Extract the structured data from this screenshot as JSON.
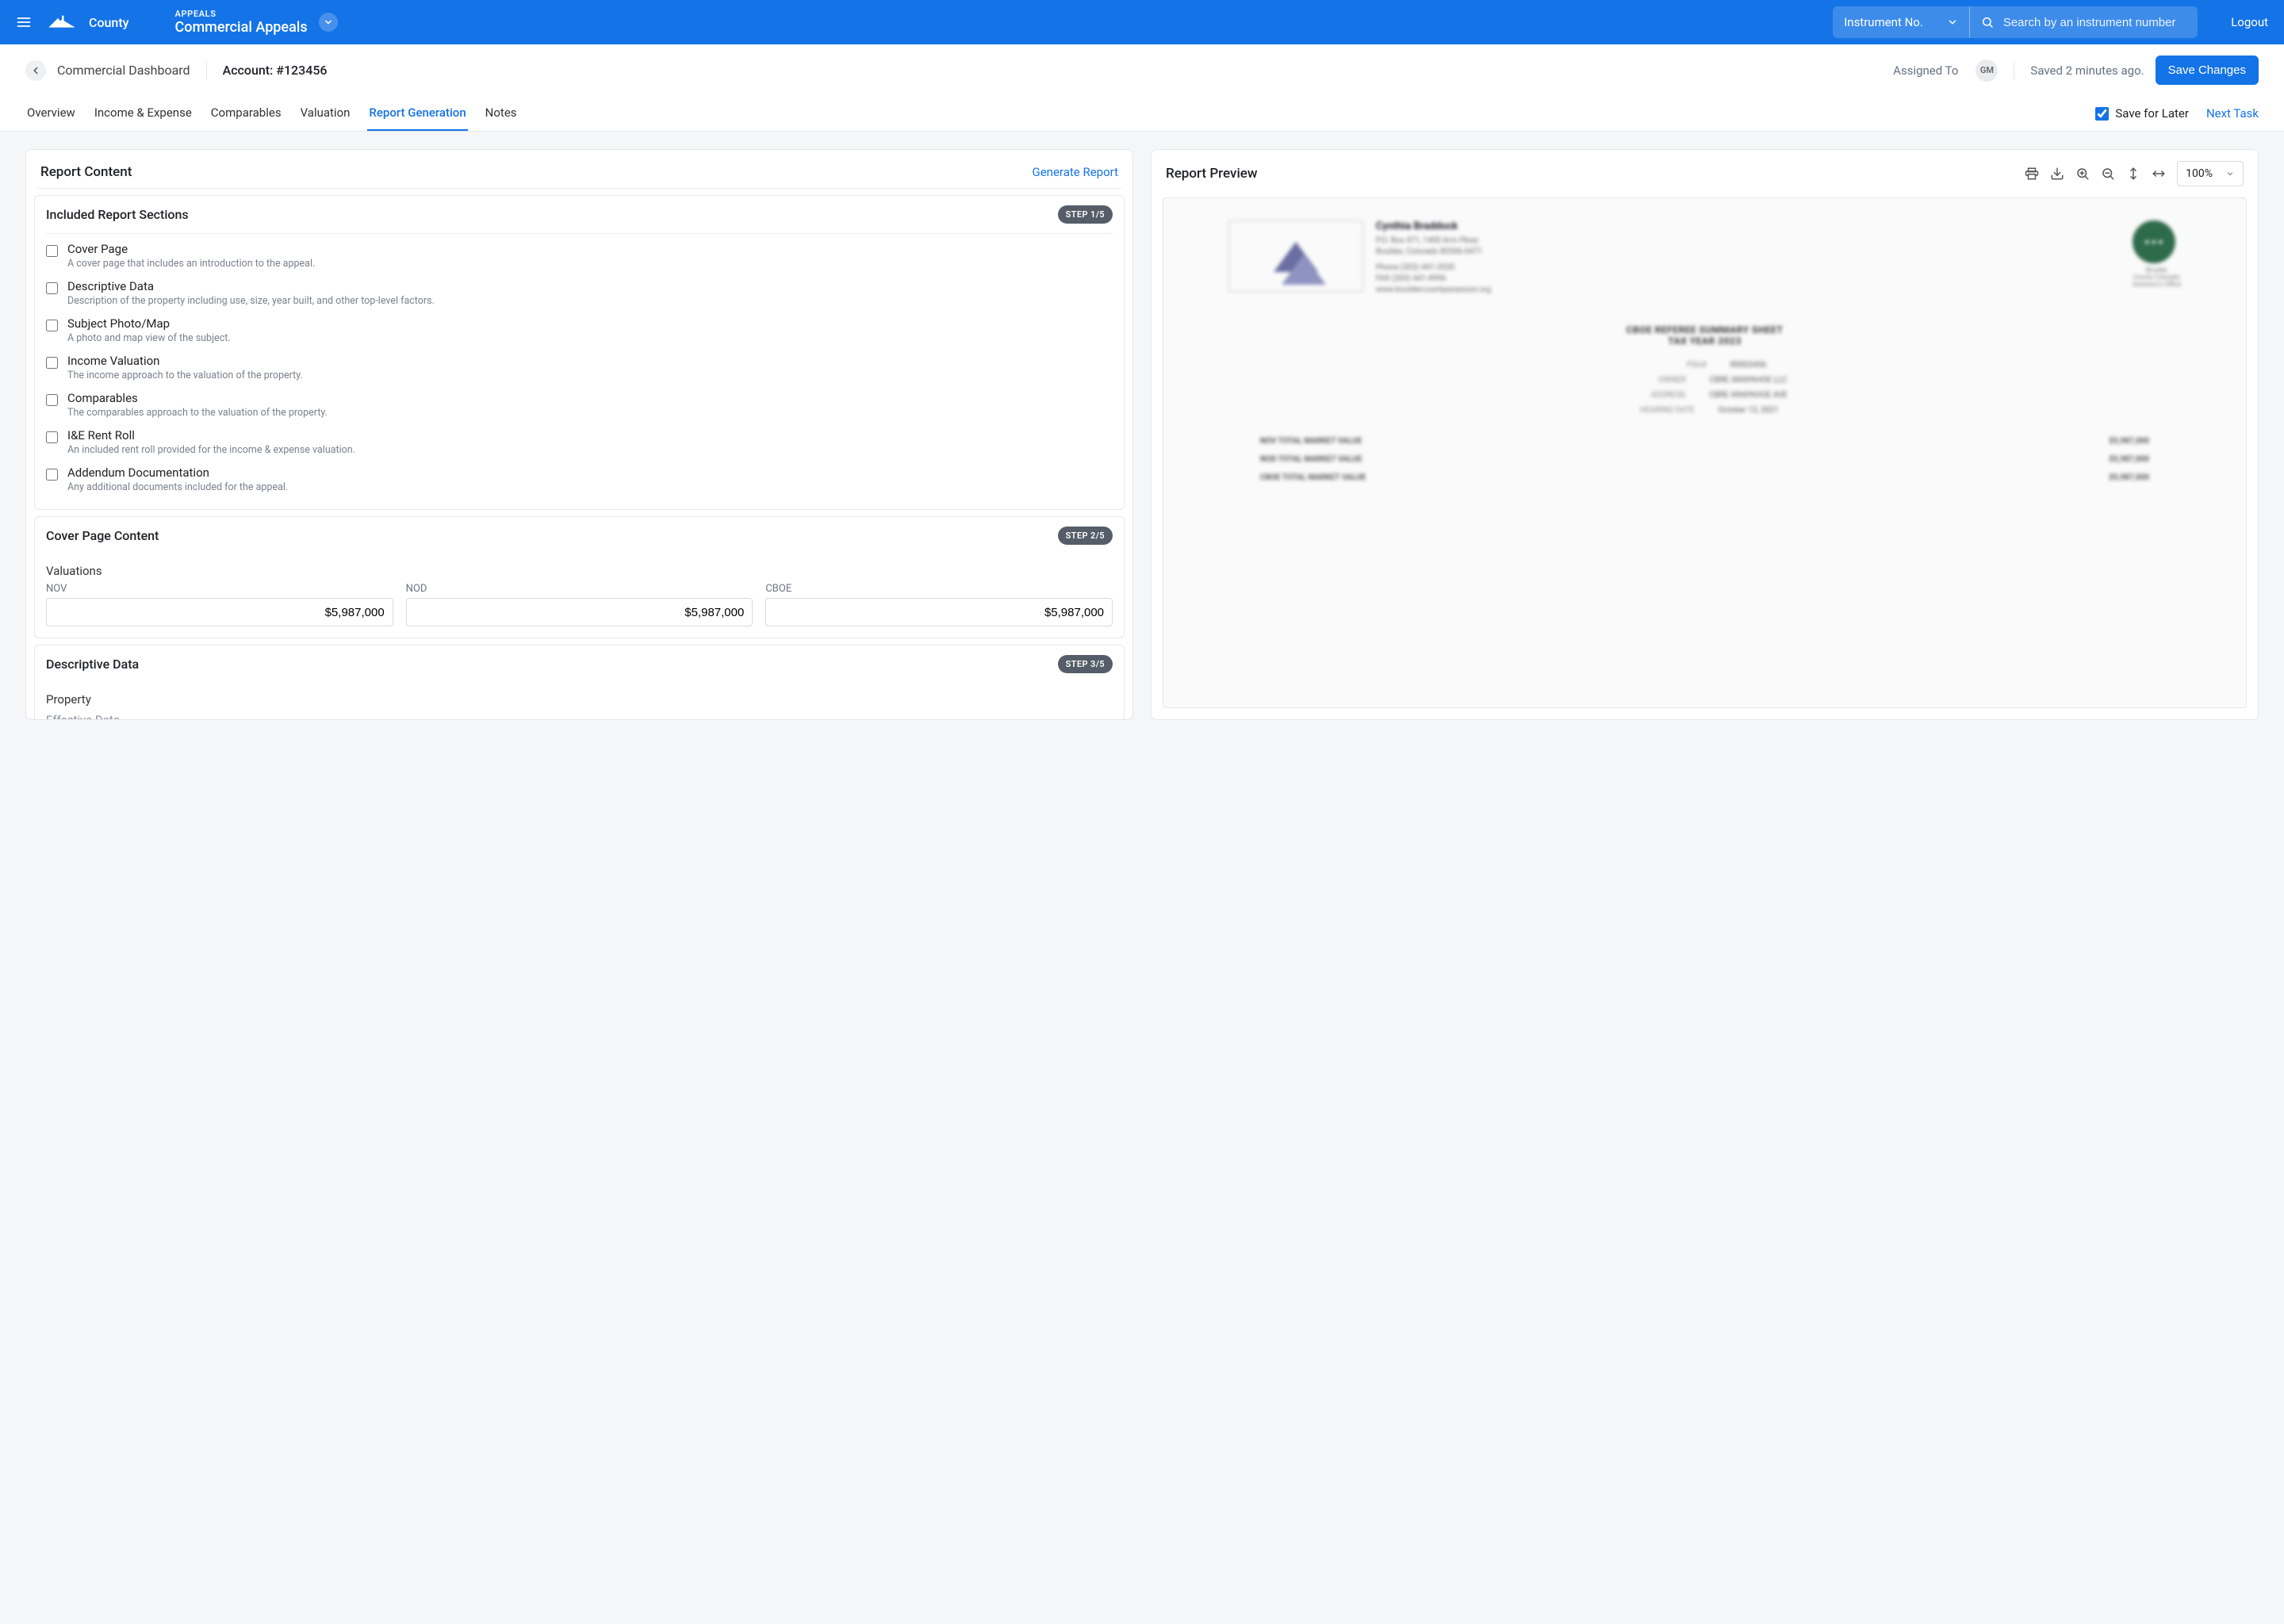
{
  "brand": "County",
  "module": {
    "eyebrow": "APPEALS",
    "title": "Commercial Appeals"
  },
  "search": {
    "filter_label": "Instrument No.",
    "placeholder": "Search by an instrument number"
  },
  "logout": "Logout",
  "breadcrumb": "Commercial Dashboard",
  "account": "Account: #123456",
  "assigned_to_label": "Assigned To",
  "assignee_initials": "GM",
  "saved_text": "Saved 2 minutes ago.",
  "save_changes": "Save Changes",
  "tabs": {
    "overview": "Overview",
    "income": "Income & Expense",
    "comparables": "Comparables",
    "valuation": "Valuation",
    "report": "Report Generation",
    "notes": "Notes"
  },
  "save_for_later": "Save for Later",
  "next_task": "Next Task",
  "left_panel": {
    "title": "Report Content",
    "generate": "Generate Report",
    "step1": {
      "title": "Included Report Sections",
      "chip": "STEP 1/5",
      "items": [
        {
          "label": "Cover Page",
          "desc": "A cover page that includes an introduction to the appeal."
        },
        {
          "label": "Descriptive Data",
          "desc": "Description of the property including use, size, year built, and other top-level factors."
        },
        {
          "label": "Subject Photo/Map",
          "desc": "A photo and map view of the subject."
        },
        {
          "label": "Income Valuation",
          "desc": "The income approach to the valuation of the property."
        },
        {
          "label": "Comparables",
          "desc": "The comparables approach to the valuation of the property."
        },
        {
          "label": "I&E Rent Roll",
          "desc": "An included rent roll provided for the income & expense valuation."
        },
        {
          "label": "Addendum Documentation",
          "desc": "Any additional documents included for the appeal."
        }
      ]
    },
    "step2": {
      "title": "Cover Page Content",
      "chip": "STEP 2/5",
      "subhead": "Valuations",
      "cols": [
        {
          "label": "NOV",
          "value": "$5,987,000"
        },
        {
          "label": "NOD",
          "value": "$5,987,000"
        },
        {
          "label": "CBOE",
          "value": "$5,987,000"
        }
      ]
    },
    "step3": {
      "title": "Descriptive Data",
      "chip": "STEP 3/5",
      "sub1": "Property",
      "sub2": "Effective Date"
    }
  },
  "right_panel": {
    "title": "Report Preview",
    "zoom": "100%"
  }
}
